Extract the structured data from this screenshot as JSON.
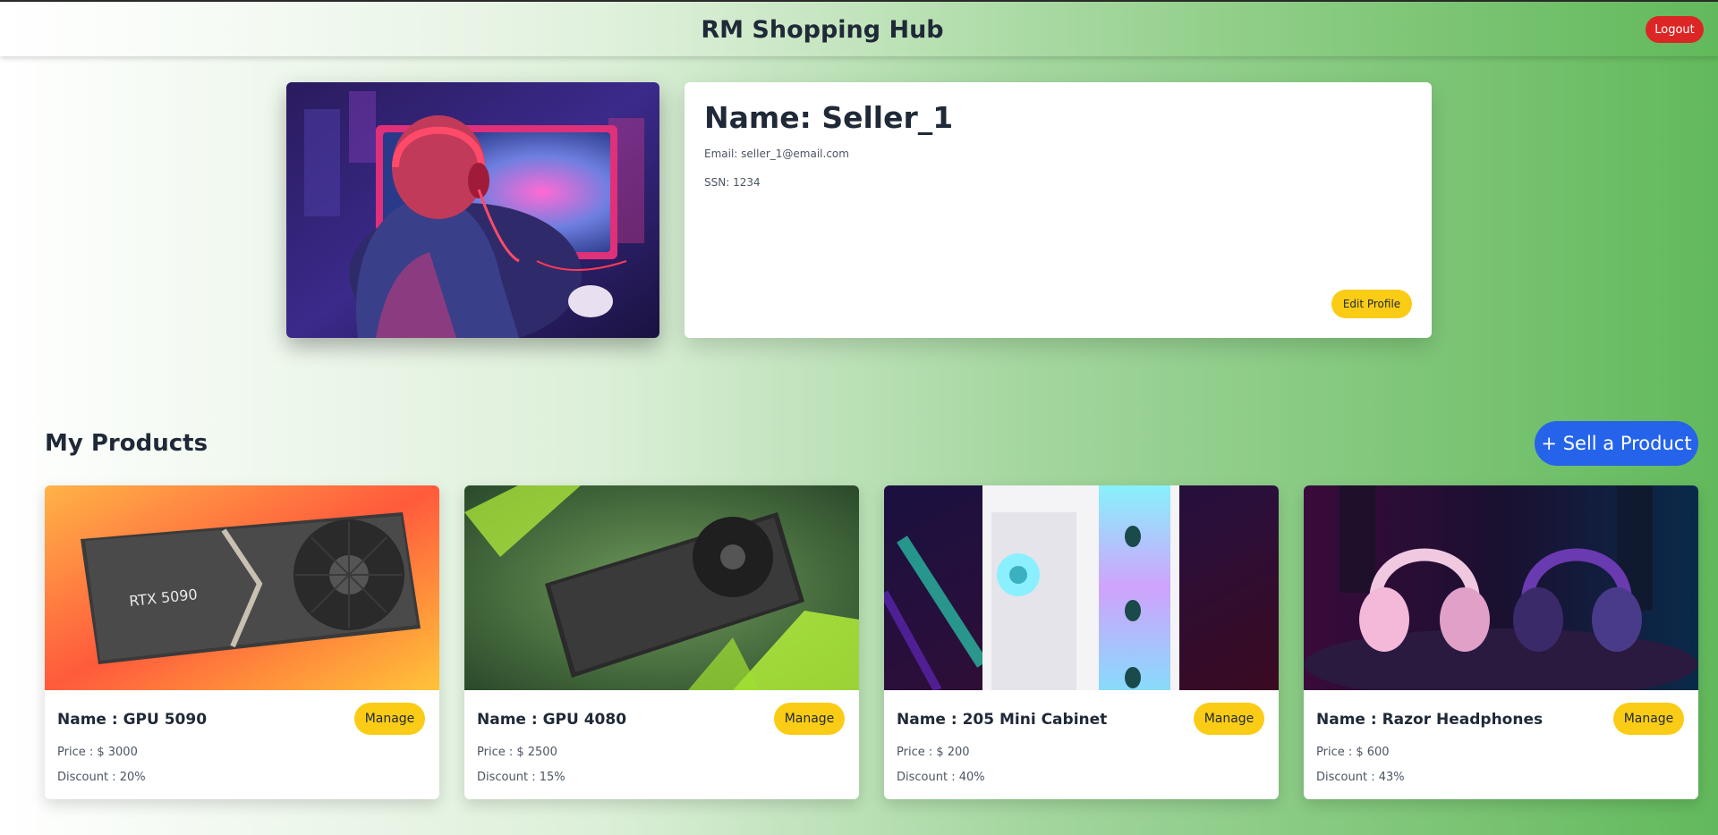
{
  "header": {
    "title": "RM Shopping Hub",
    "logout_label": "Logout"
  },
  "profile": {
    "name": "Name: Seller_1",
    "email": "Email: seller_1@email.com",
    "ssn": "SSN: 1234",
    "edit_label": "Edit Profile",
    "image_icon": "gamer-illustration-image"
  },
  "products_section": {
    "title": "My Products",
    "sell_label": "+ Sell a Product",
    "items": [
      {
        "name": "Name : GPU 5090",
        "price": "Price : $ 3000",
        "discount": "Discount : 20%",
        "manage_label": "Manage",
        "image_label": "RTX 5090",
        "image_icon": "gpu-image"
      },
      {
        "name": "Name : GPU 4080",
        "price": "Price : $ 2500",
        "discount": "Discount : 15%",
        "manage_label": "Manage",
        "image_icon": "gpu-image"
      },
      {
        "name": "Name : 205 Mini Cabinet",
        "price": "Price : $ 200",
        "discount": "Discount : 40%",
        "manage_label": "Manage",
        "image_icon": "pc-cabinet-image"
      },
      {
        "name": "Name : Razor Headphones",
        "price": "Price : $ 600",
        "discount": "Discount : 43%",
        "manage_label": "Manage",
        "image_icon": "headphones-image"
      }
    ]
  },
  "colors": {
    "logout": "#dc2626",
    "accent_yellow": "#facc15",
    "sell_blue": "#2563eb",
    "bg_green": "#62b95b"
  }
}
